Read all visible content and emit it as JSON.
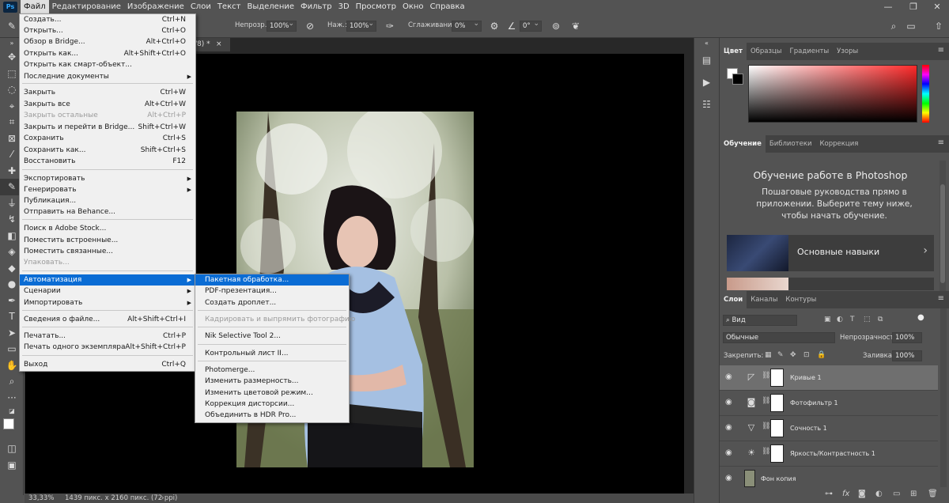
{
  "menubar": {
    "logo": "Ps",
    "items": [
      "Файл",
      "Редактирование",
      "Изображение",
      "Слои",
      "Текст",
      "Выделение",
      "Фильтр",
      "3D",
      "Просмотр",
      "Окно",
      "Справка"
    ],
    "window_controls": [
      "—",
      "❐",
      "✕"
    ]
  },
  "options": {
    "opacity_label": "Непрозр.:",
    "opacity_value": "100%",
    "press_label": "Наж.:",
    "press_value": "100%",
    "smooth_label": "Сглаживание:",
    "smooth_value": "0%",
    "angle_value": "0°"
  },
  "document": {
    "tab_suffix": "/8) *"
  },
  "status": {
    "zoom": "33,33%",
    "dims": "1439 пикс. x 2160 пикс. (72 ppi)"
  },
  "file_menu": {
    "items": [
      {
        "label": "Создать...",
        "shortcut": "Ctrl+N"
      },
      {
        "label": "Открыть...",
        "shortcut": "Ctrl+O"
      },
      {
        "label": "Обзор в Bridge...",
        "shortcut": "Alt+Ctrl+O"
      },
      {
        "label": "Открыть как...",
        "shortcut": "Alt+Shift+Ctrl+O"
      },
      {
        "label": "Открыть как смарт-объект...",
        "shortcut": ""
      },
      {
        "label": "Последние документы",
        "shortcut": ""
      },
      {
        "label": "Закрыть",
        "shortcut": "Ctrl+W"
      },
      {
        "label": "Закрыть все",
        "shortcut": "Alt+Ctrl+W"
      },
      {
        "label": "Закрыть остальные",
        "shortcut": "Alt+Ctrl+P"
      },
      {
        "label": "Закрыть и перейти в Bridge...",
        "shortcut": "Shift+Ctrl+W"
      },
      {
        "label": "Сохранить",
        "shortcut": "Ctrl+S"
      },
      {
        "label": "Сохранить как...",
        "shortcut": "Shift+Ctrl+S"
      },
      {
        "label": "Восстановить",
        "shortcut": "F12"
      },
      {
        "label": "Экспортировать",
        "shortcut": ""
      },
      {
        "label": "Генерировать",
        "shortcut": ""
      },
      {
        "label": "Публикация...",
        "shortcut": ""
      },
      {
        "label": "Отправить на Behance...",
        "shortcut": ""
      },
      {
        "label": "Поиск в Adobe Stock...",
        "shortcut": ""
      },
      {
        "label": "Поместить встроенные...",
        "shortcut": ""
      },
      {
        "label": "Поместить связанные...",
        "shortcut": ""
      },
      {
        "label": "Упаковать...",
        "shortcut": ""
      },
      {
        "label": "Автоматизация",
        "shortcut": ""
      },
      {
        "label": "Сценарии",
        "shortcut": ""
      },
      {
        "label": "Импортировать",
        "shortcut": ""
      },
      {
        "label": "Сведения о файле...",
        "shortcut": "Alt+Shift+Ctrl+I"
      },
      {
        "label": "Печатать...",
        "shortcut": "Ctrl+P"
      },
      {
        "label": "Печать одного экземпляра",
        "shortcut": "Alt+Shift+Ctrl+P"
      },
      {
        "label": "Выход",
        "shortcut": "Ctrl+Q"
      }
    ]
  },
  "automation_menu": {
    "items": [
      "Пакетная обработка...",
      "PDF-презентация...",
      "Создать дроплет...",
      "Кадрировать и выпрямить фотографию",
      "Nik Selective Tool 2...",
      "Контрольный лист II...",
      "Photomerge...",
      "Изменить размерность...",
      "Изменить цветовой режим...",
      "Коррекция дисторсии...",
      "Объединить в HDR Pro..."
    ]
  },
  "color_panel": {
    "tabs": [
      "Цвет",
      "Образцы",
      "Градиенты",
      "Узоры"
    ]
  },
  "learn_panel": {
    "tabs": [
      "Обучение",
      "Библиотеки",
      "Коррекция"
    ],
    "title": "Обучение работе в Photoshop",
    "description": "Пошаговые руководства прямо в приложении. Выберите тему ниже, чтобы начать обучение.",
    "card_title": "Основные навыки"
  },
  "layers_panel": {
    "tabs": [
      "Слои",
      "Каналы",
      "Контуры"
    ],
    "filter": "Вид",
    "blend_mode": "Обычные",
    "opacity_label": "Непрозрачность:",
    "opacity_value": "100%",
    "lock_label": "Закрепить:",
    "fill_label": "Заливка:",
    "fill_value": "100%",
    "layers": [
      "Кривые 1",
      "Фотофильтр 1",
      "Сочность 1",
      "Яркость/Контрастность 1",
      "Фон копия"
    ]
  },
  "colors": {
    "menu_highlight": "#0a6cd4",
    "canvas": "#000000",
    "panel": "#535353"
  }
}
